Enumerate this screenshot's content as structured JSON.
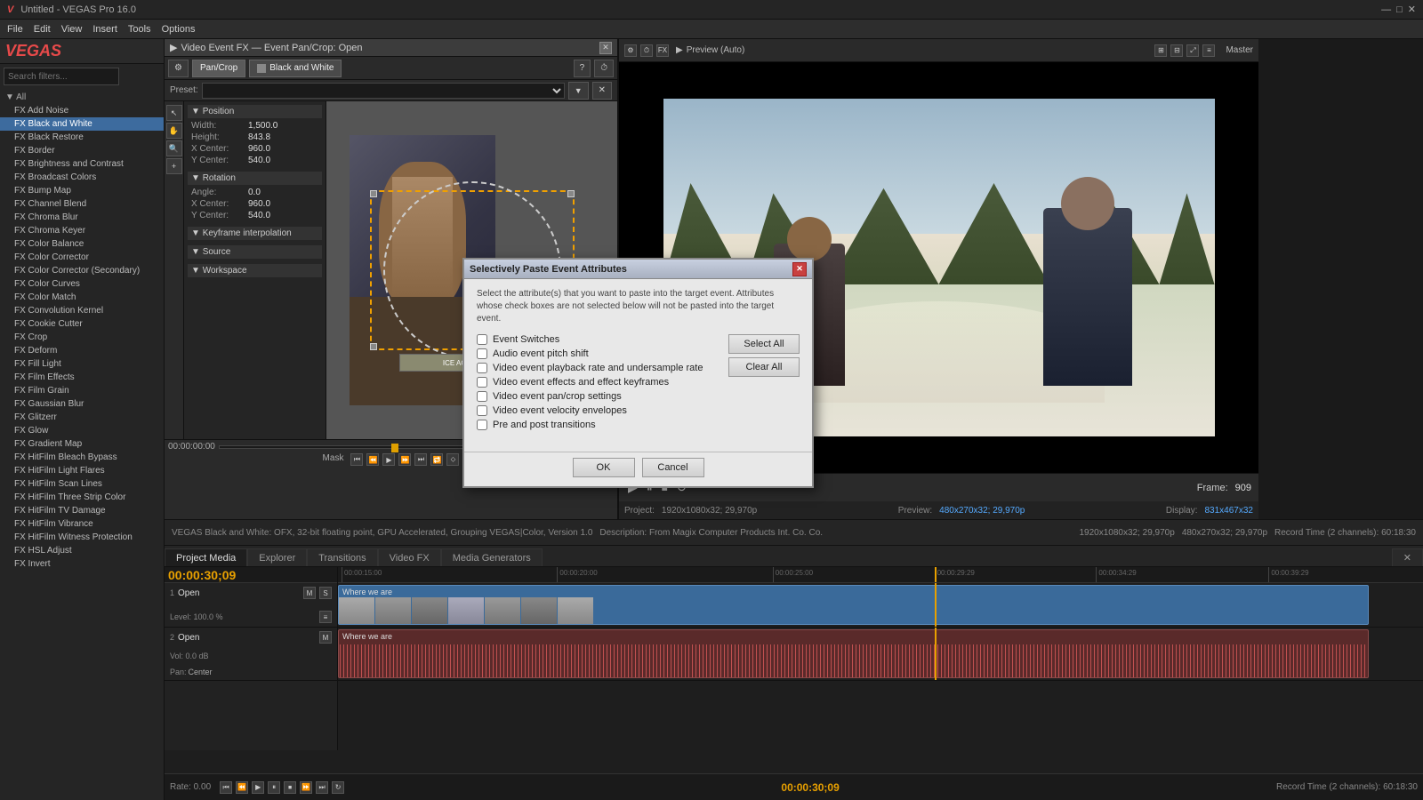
{
  "app": {
    "title": "Untitled - VEGAS Pro 16.0",
    "version": "VEGAS Pro 16.0"
  },
  "menubar": {
    "items": [
      "File",
      "Edit",
      "View",
      "Insert",
      "Tools",
      "Options"
    ]
  },
  "sidebar": {
    "search_placeholder": "Search filters...",
    "all_label": "All",
    "fx_items": [
      "Add Noise",
      "Black and White",
      "Black Restore",
      "Border",
      "Brightness and Contrast",
      "Broadcast Colors",
      "Bump Map",
      "Channel Blend",
      "Chroma Blur",
      "Chroma Keyer",
      "Color Balance",
      "Color Corrector",
      "Color Corrector (Secondary)",
      "Color Curves",
      "Color Match",
      "Convolution Kernel",
      "Cookie Cutter",
      "Crop",
      "Deform",
      "Fill Light",
      "Film Effects",
      "Film Grain",
      "Gaussian Blur",
      "Glitzerr",
      "Glow",
      "Gradient Map",
      "HitFilm Bleach Bypass",
      "HitFilm Light Flares",
      "HitFilm Scan Lines",
      "HitFilm Three Strip Color",
      "HitFilm TV Damage",
      "HitFilm Vibrance",
      "HitFilm Witness Protection",
      "HSL Adjust",
      "Invert"
    ]
  },
  "vefx_window": {
    "title": "Video Event FX",
    "subtitle": "Event Pan/Crop: Open",
    "tab_pancrop": "Pan/Crop",
    "tab_blackwhite": "Black and White",
    "preset_label": "Preset:",
    "preset_value": "",
    "position_section": "Position",
    "params": {
      "width_label": "Width:",
      "width_value": "1,500.0",
      "height_label": "Height:",
      "height_value": "843.8",
      "x_center_label": "X Center:",
      "x_center_value": "960.0",
      "y_center_label": "Y Center:",
      "y_center_value": "540.0"
    },
    "rotation_section": "Rotation",
    "rotation_params": {
      "angle_label": "Angle:",
      "angle_value": "0.0",
      "x_center_label": "X Center:",
      "x_center_value": "960.0",
      "y_center_label": "Y Center:",
      "y_center_value": "540.0"
    },
    "keyframe_section": "Keyframe interpolation",
    "source_section": "Source",
    "workspace_section": "Workspace",
    "mask_label": "Mask"
  },
  "dialog": {
    "title": "Selectively Paste Event Attributes",
    "description": "Select the attribute(s) that you want to paste into the target event. Attributes whose check boxes are not selected below will not be pasted into the target event.",
    "checkboxes": [
      {
        "label": "Event Switches",
        "checked": false
      },
      {
        "label": "Audio event pitch shift",
        "checked": false
      },
      {
        "label": "Video event playback rate and undersample rate",
        "checked": false
      },
      {
        "label": "Video event effects and effect keyframes",
        "checked": false
      },
      {
        "label": "Video event pan/crop settings",
        "checked": false
      },
      {
        "label": "Video event velocity envelopes",
        "checked": false
      },
      {
        "label": "Pre and post transitions",
        "checked": false
      }
    ],
    "select_all_btn": "Select All",
    "clear_all_btn": "Clear All",
    "ok_btn": "OK",
    "cancel_btn": "Cancel"
  },
  "preview": {
    "title": "Preview (Auto)",
    "frame_label": "Frame:",
    "frame_value": "909",
    "display_label": "Display:",
    "display_value": "831x467x32",
    "project_label": "Project:",
    "project_value": "1920x1080x32; 29,970p",
    "preview_res": "480x270x32; 29,970p"
  },
  "timeline": {
    "timecode": "00:00:30;09",
    "tabs": [
      "Project Media",
      "Explorer",
      "Transitions",
      "Video FX",
      "Media Generators"
    ],
    "track1_name": "Open",
    "track1_clip": "Where we are",
    "track2_name": "Open",
    "track2_clip": "Where we are",
    "time_markers": [
      "00:00:15:00",
      "00:00:20:00",
      "00:00:25:00",
      "00:00:29:29",
      "00:00:34:29",
      "00:00:39:29"
    ],
    "status_text": "VEGAS Black and White: OFX, 32-bit floating point, GPU Accelerated, Grouping VEGAS|Color, Version 1.0",
    "status_desc": "Description: From Magix Computer Products Int. Co. Co.",
    "record_time": "Record Time (2 channels): 60:18:30",
    "rate": "Rate: 0.00"
  },
  "transport": {
    "timecode": "00:00:30;09"
  }
}
